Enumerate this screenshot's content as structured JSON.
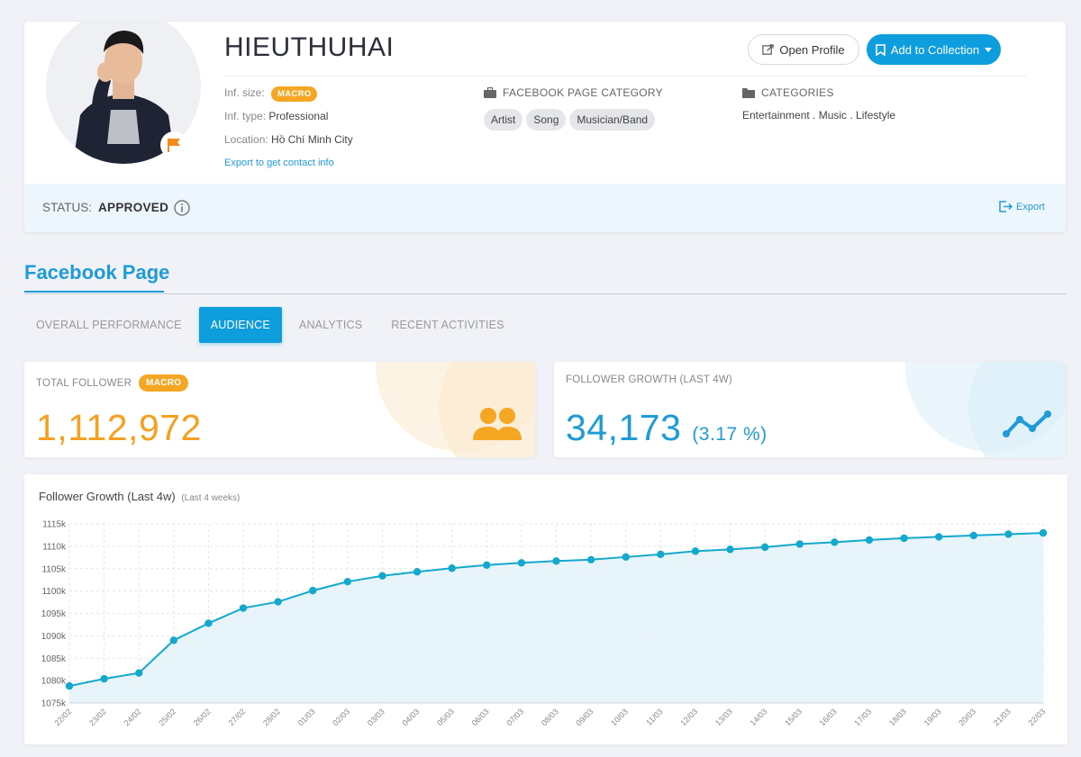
{
  "profile": {
    "name": "HIEUTHUHAI",
    "open_profile_label": "Open Profile",
    "add_collection_label": "Add to Collection",
    "inf_size_label": "Inf. size:",
    "inf_size_badge": "MACRO",
    "inf_type_label": "Inf. type:",
    "inf_type_value": "Professional",
    "location_label": "Location:",
    "location_value": "Hồ Chí Minh City",
    "export_contact_label": "Export to get contact info",
    "fb_category_heading": "FACEBOOK PAGE CATEGORY",
    "fb_categories": [
      "Artist",
      "Song",
      "Musician/Band"
    ],
    "categories_heading": "CATEGORIES",
    "categories_value": "Entertainment . Music . Lifestyle",
    "status_label": "STATUS:",
    "status_value": "APPROVED",
    "export_label": "Export"
  },
  "section": {
    "title": "Facebook Page",
    "tabs": [
      {
        "label": "OVERALL PERFORMANCE",
        "active": false
      },
      {
        "label": "AUDIENCE",
        "active": true
      },
      {
        "label": "ANALYTICS",
        "active": false
      },
      {
        "label": "RECENT ACTIVITIES",
        "active": false
      }
    ]
  },
  "stats": {
    "total_follower_label": "TOTAL FOLLOWER",
    "total_follower_badge": "MACRO",
    "total_follower_value": "1,112,972",
    "growth_label": "FOLLOWER GROWTH (LAST 4W)",
    "growth_value": "34,173",
    "growth_percent": "(3.17 %)"
  },
  "colors": {
    "accent": "#0e9ede",
    "orange": "#f5a623",
    "line": "#14a9cc"
  },
  "chart_data": {
    "type": "area",
    "title": "Follower Growth (Last 4w)",
    "subtitle": "(Last 4 weeks)",
    "categories": [
      "22/02",
      "23/02",
      "24/02",
      "25/02",
      "26/02",
      "27/02",
      "28/02",
      "01/03",
      "02/03",
      "03/03",
      "04/03",
      "05/03",
      "06/03",
      "07/03",
      "08/03",
      "09/03",
      "10/03",
      "11/03",
      "12/03",
      "13/03",
      "14/03",
      "15/03",
      "16/03",
      "17/03",
      "18/03",
      "19/03",
      "20/03",
      "21/03",
      "22/03"
    ],
    "values": [
      1078.8,
      1080.4,
      1081.7,
      1089.0,
      1092.8,
      1096.2,
      1097.6,
      1100.1,
      1102.1,
      1103.4,
      1104.3,
      1105.1,
      1105.8,
      1106.3,
      1106.7,
      1107.0,
      1107.6,
      1108.2,
      1108.9,
      1109.3,
      1109.8,
      1110.5,
      1110.9,
      1111.4,
      1111.8,
      1112.1,
      1112.4,
      1112.7,
      1112.97
    ],
    "yticks": [
      "1075k",
      "1080k",
      "1085k",
      "1090k",
      "1095k",
      "1100k",
      "1105k",
      "1110k",
      "1115k"
    ],
    "ylim": [
      1075,
      1115
    ],
    "grid": true
  }
}
